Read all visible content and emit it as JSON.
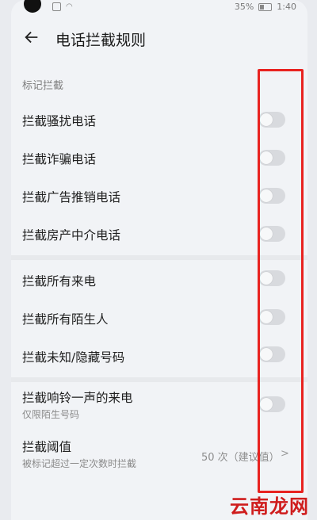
{
  "status_bar": {
    "battery_percent": "35%",
    "time": "1:40"
  },
  "header": {
    "title": "电话拦截规则"
  },
  "section_label": "标记拦截",
  "rows": [
    {
      "label": "拦截骚扰电话"
    },
    {
      "label": "拦截诈骗电话"
    },
    {
      "label": "拦截广告推销电话"
    },
    {
      "label": "拦截房产中介电话"
    },
    {
      "label": "拦截所有来电"
    },
    {
      "label": "拦截所有陌生人"
    },
    {
      "label": "拦截未知/隐藏号码"
    },
    {
      "label": "拦截响铃一声的来电",
      "sub": "仅限陌生号码"
    }
  ],
  "threshold": {
    "label": "拦截阈值",
    "sub": "被标记超过一定次数时拦截",
    "value": "50 次（建议值）"
  },
  "toggle_states": [
    false,
    false,
    false,
    false,
    false,
    false,
    false,
    false
  ],
  "colors": {
    "highlight": "#e8221f",
    "watermark": "#cf1d1d"
  },
  "watermark": "云南龙网"
}
